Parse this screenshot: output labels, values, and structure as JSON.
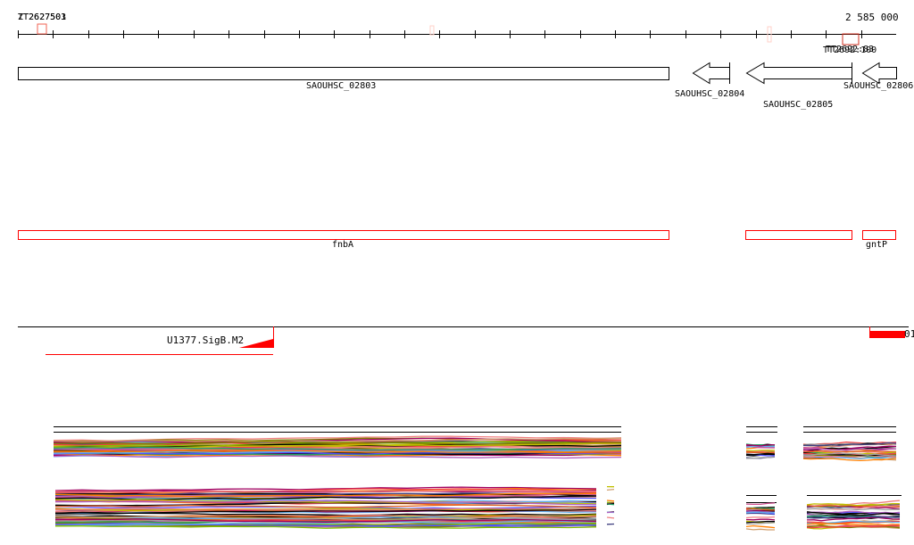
{
  "ruler": {
    "start_labels": [
      "TT2627501",
      "ZT2627503"
    ],
    "end_label": "2 585 000",
    "marker_labels": [
      "TT2692:100",
      "TT2692:83"
    ]
  },
  "genes": [
    {
      "name": "SAOUHSC_02803",
      "strand": "+"
    },
    {
      "name": "SAOUHSC_02804",
      "strand": "-"
    },
    {
      "name": "SAOUHSC_02805",
      "strand": "-"
    },
    {
      "name": "SAOUHSC_02806",
      "strand": "-"
    }
  ],
  "operons": [
    {
      "name": "fnbA"
    },
    {
      "name": ""
    },
    {
      "name": "gntP"
    }
  ],
  "regulation": {
    "motif_label": "U1377.SigB.M2",
    "right_label": "01"
  },
  "colors": {
    "feature_red": "#ff0000",
    "marker_pink": "#ffd0c8"
  }
}
